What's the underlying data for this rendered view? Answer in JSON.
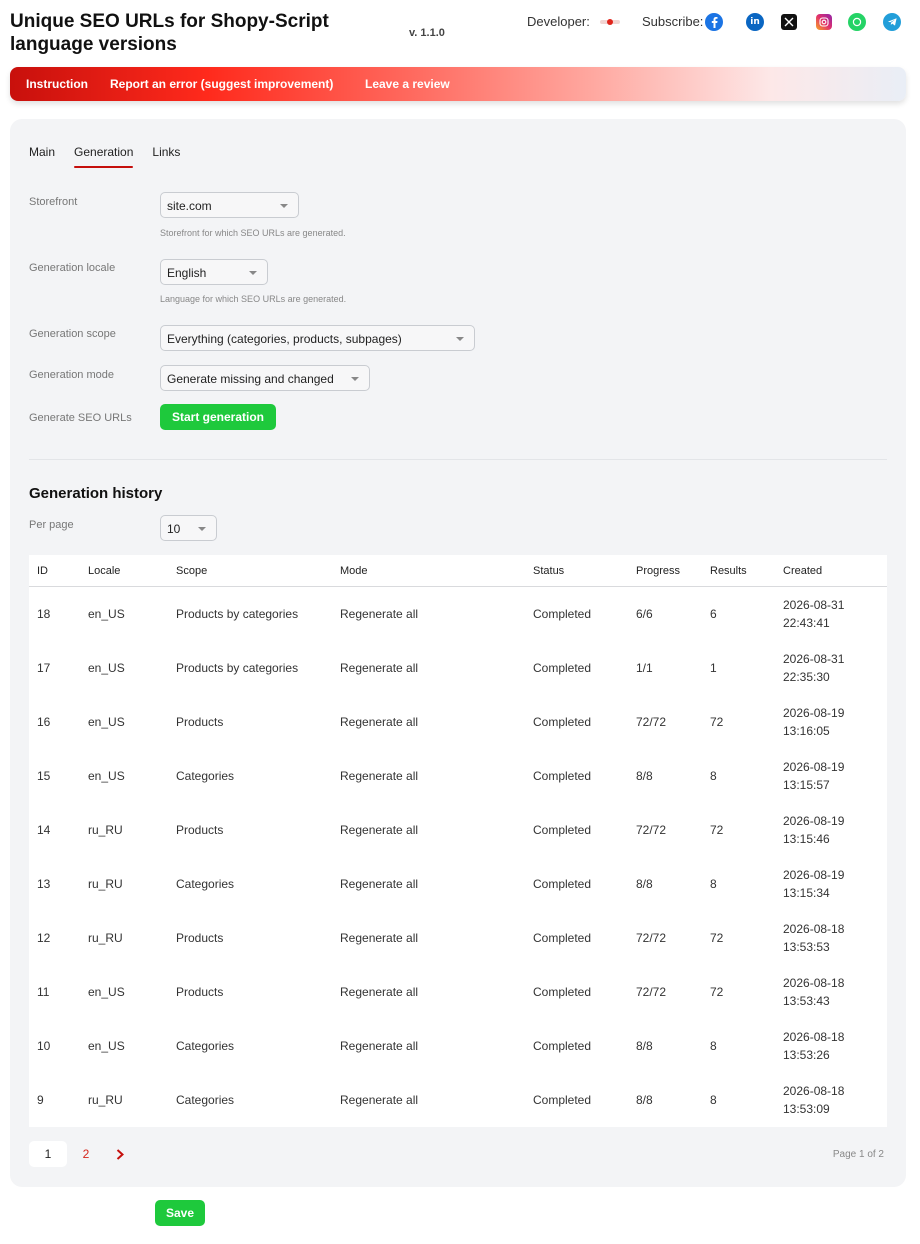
{
  "header": {
    "title": "Unique SEO URLs for Shopy-Script language versions",
    "version": "v. 1.1.0",
    "developer_label": "Developer:",
    "subscribe_label": "Subscribe:",
    "social": [
      {
        "name": "facebook",
        "color": "#1b74e4"
      },
      {
        "name": "linkedin",
        "color": "#0a66c2"
      },
      {
        "name": "x",
        "color": "#111111"
      },
      {
        "name": "instagram",
        "color": "#e1306c"
      },
      {
        "name": "whatsapp",
        "color": "#25d366"
      },
      {
        "name": "telegram",
        "color": "#229ed9"
      }
    ]
  },
  "nav": {
    "instruction": "Instruction",
    "report": "Report an error (suggest improvement)",
    "review": "Leave a review"
  },
  "tabs": [
    {
      "label": "Main",
      "active": false
    },
    {
      "label": "Generation",
      "active": true
    },
    {
      "label": "Links",
      "active": false
    }
  ],
  "form": {
    "storefront": {
      "label": "Storefront",
      "value": "site.com",
      "hint": "Storefront for which SEO URLs are generated."
    },
    "locale": {
      "label": "Generation locale",
      "value": "English",
      "hint": "Language for which SEO URLs are generated."
    },
    "scope": {
      "label": "Generation scope",
      "value": "Everything (categories, products, subpages)"
    },
    "mode": {
      "label": "Generation mode",
      "value": "Generate missing and changed"
    },
    "generate": {
      "label": "Generate SEO URLs",
      "button": "Start generation"
    }
  },
  "history": {
    "title": "Generation history",
    "per_page_label": "Per page",
    "per_page_value": "10",
    "columns": [
      "ID",
      "Locale",
      "Scope",
      "Mode",
      "Status",
      "Progress",
      "Results",
      "Created"
    ],
    "rows": [
      {
        "id": "18",
        "locale": "en_US",
        "scope": "Products by categories",
        "mode": "Regenerate all",
        "status": "Completed",
        "progress": "6/6",
        "results": "6",
        "date": "2026-08-31",
        "time": "22:43:41"
      },
      {
        "id": "17",
        "locale": "en_US",
        "scope": "Products by categories",
        "mode": "Regenerate all",
        "status": "Completed",
        "progress": "1/1",
        "results": "1",
        "date": "2026-08-31",
        "time": "22:35:30"
      },
      {
        "id": "16",
        "locale": "en_US",
        "scope": "Products",
        "mode": "Regenerate all",
        "status": "Completed",
        "progress": "72/72",
        "results": "72",
        "date": "2026-08-19",
        "time": "13:16:05"
      },
      {
        "id": "15",
        "locale": "en_US",
        "scope": "Categories",
        "mode": "Regenerate all",
        "status": "Completed",
        "progress": "8/8",
        "results": "8",
        "date": "2026-08-19",
        "time": "13:15:57"
      },
      {
        "id": "14",
        "locale": "ru_RU",
        "scope": "Products",
        "mode": "Regenerate all",
        "status": "Completed",
        "progress": "72/72",
        "results": "72",
        "date": "2026-08-19",
        "time": "13:15:46"
      },
      {
        "id": "13",
        "locale": "ru_RU",
        "scope": "Categories",
        "mode": "Regenerate all",
        "status": "Completed",
        "progress": "8/8",
        "results": "8",
        "date": "2026-08-19",
        "time": "13:15:34"
      },
      {
        "id": "12",
        "locale": "ru_RU",
        "scope": "Products",
        "mode": "Regenerate all",
        "status": "Completed",
        "progress": "72/72",
        "results": "72",
        "date": "2026-08-18",
        "time": "13:53:53"
      },
      {
        "id": "11",
        "locale": "en_US",
        "scope": "Products",
        "mode": "Regenerate all",
        "status": "Completed",
        "progress": "72/72",
        "results": "72",
        "date": "2026-08-18",
        "time": "13:53:43"
      },
      {
        "id": "10",
        "locale": "en_US",
        "scope": "Categories",
        "mode": "Regenerate all",
        "status": "Completed",
        "progress": "8/8",
        "results": "8",
        "date": "2026-08-18",
        "time": "13:53:26"
      },
      {
        "id": "9",
        "locale": "ru_RU",
        "scope": "Categories",
        "mode": "Regenerate all",
        "status": "Completed",
        "progress": "8/8",
        "results": "8",
        "date": "2026-08-18",
        "time": "13:53:09"
      }
    ],
    "pagination": {
      "pages": [
        "1",
        "2"
      ],
      "current": "1",
      "info": "Page 1 of 2"
    }
  },
  "save_button": "Save"
}
